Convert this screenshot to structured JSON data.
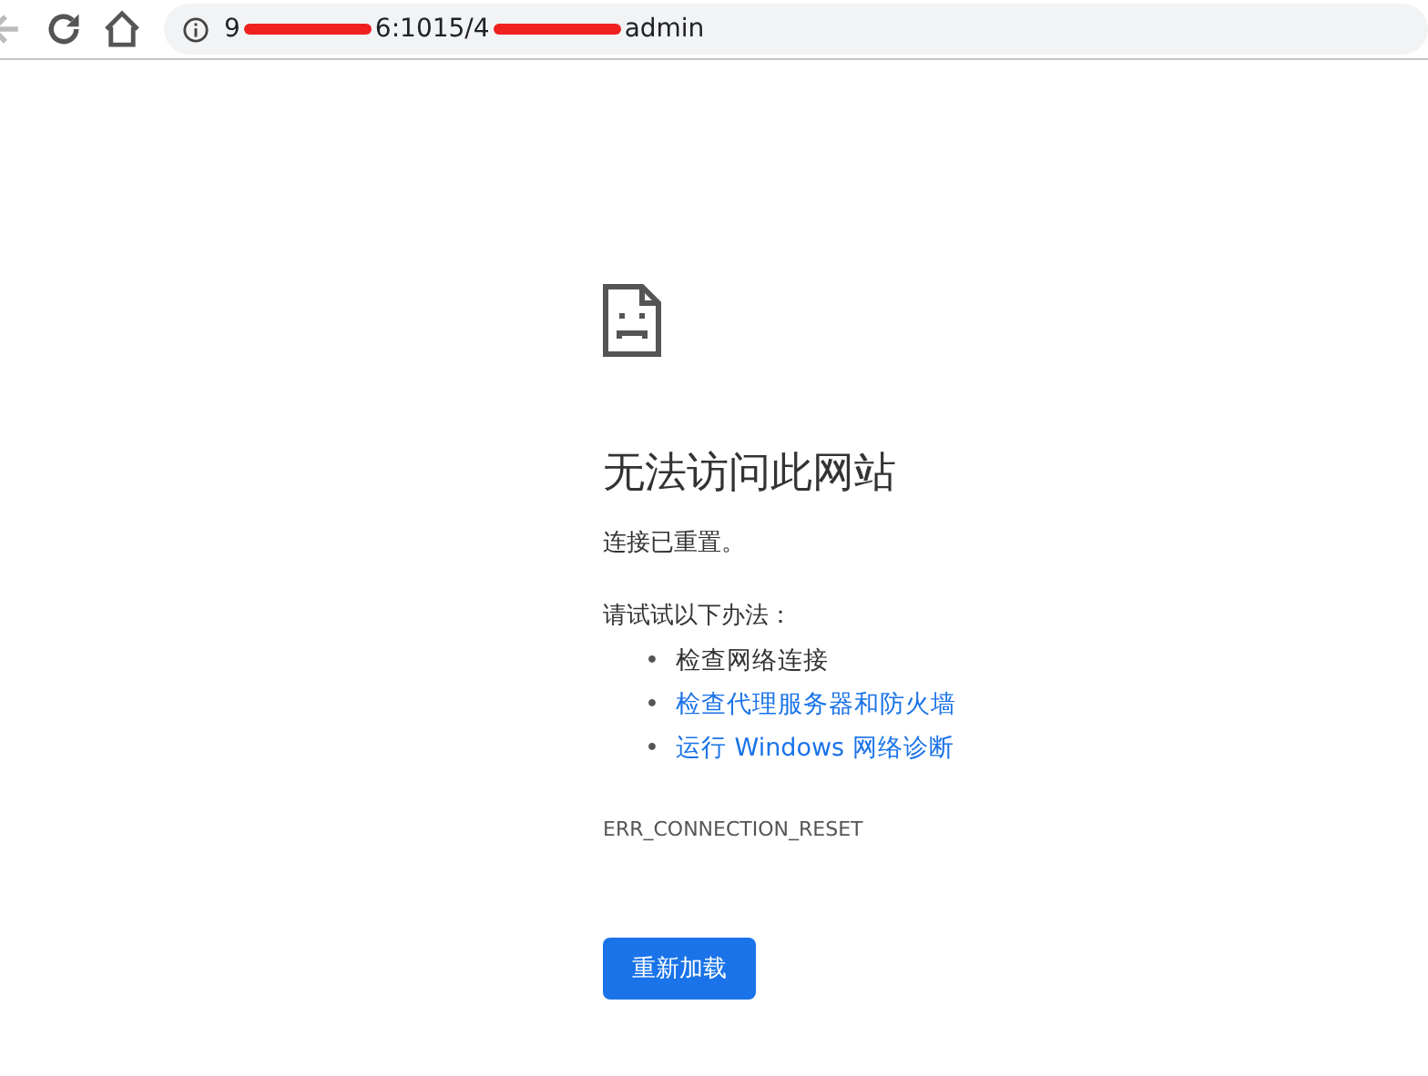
{
  "toolbar": {
    "back_disabled": true,
    "url_parts": [
      "9",
      "6:1015/4",
      "admin"
    ]
  },
  "error": {
    "title": "无法访问此网站",
    "message": "连接已重置。",
    "suggestions_heading": "请试试以下办法：",
    "suggestions": [
      {
        "bullet": "•",
        "text": "检查网络连接",
        "link": false
      },
      {
        "bullet": "•",
        "text": "检查代理服务器和防火墙",
        "link": true
      },
      {
        "bullet": "•",
        "text": "运行 Windows 网络诊断",
        "link": true
      }
    ],
    "code": "ERR_CONNECTION_RESET",
    "button": "重新加载"
  }
}
